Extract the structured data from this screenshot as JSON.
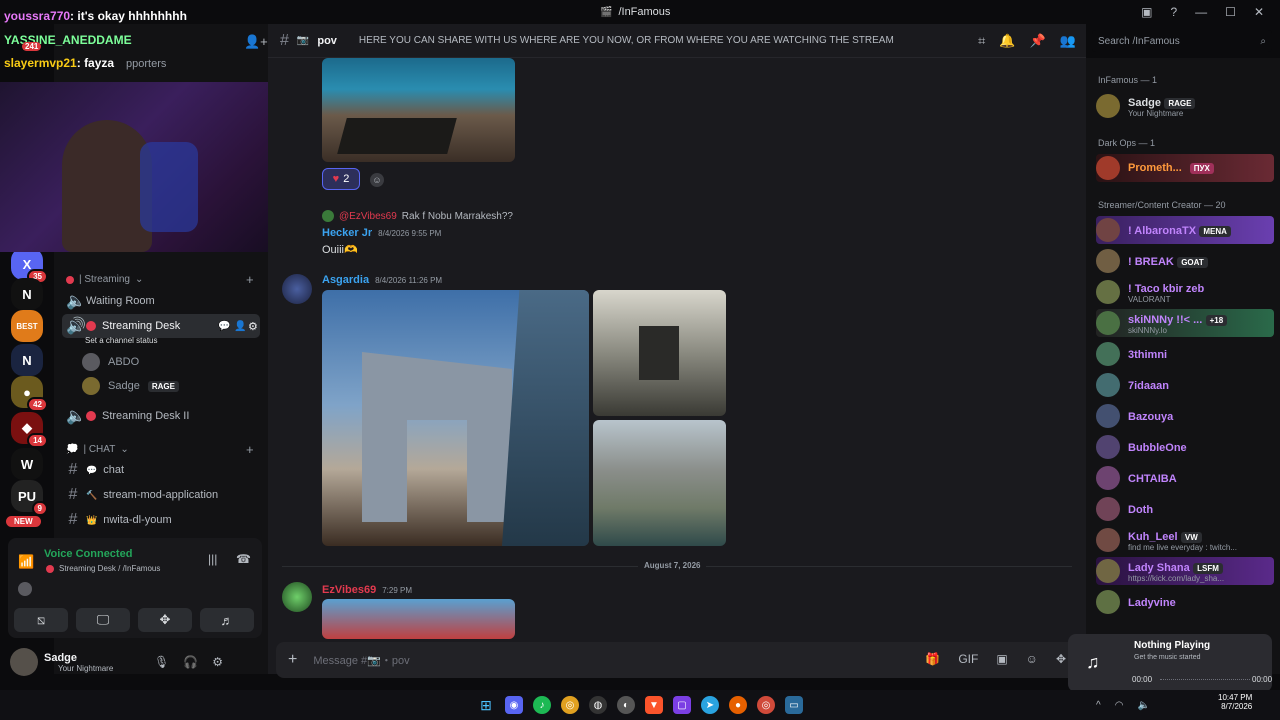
{
  "window": {
    "title": "/InFamous"
  },
  "stream_overlay": {
    "chat": [
      {
        "user": "youssra770",
        "text": ": it's okay hhhhhhhh"
      },
      {
        "user": "YASSINE_ANEDDAME",
        "text": ""
      },
      {
        "user": "slayermvp21",
        "text": ": fayza"
      }
    ],
    "badge_241": "241",
    "supporters_fragment": "pporters"
  },
  "servers": [
    {
      "name": "server-x",
      "glyph": "X",
      "badge": "35",
      "color": "#5865f2"
    },
    {
      "name": "server-n",
      "glyph": "N",
      "badge": "",
      "color": "#111"
    },
    {
      "name": "server-best",
      "glyph": "BEST",
      "badge": "",
      "color": "#e07b1a"
    },
    {
      "name": "server-nexora",
      "glyph": "N",
      "badge": "",
      "color": "#1a2440"
    },
    {
      "name": "server-gold",
      "glyph": "●",
      "badge": "42",
      "color": "#6b5a1e"
    },
    {
      "name": "server-red",
      "glyph": "◆",
      "badge": "14",
      "color": "#7a1010"
    },
    {
      "name": "server-w",
      "glyph": "W",
      "badge": "",
      "color": "#111"
    },
    {
      "name": "server-pu",
      "glyph": "PU",
      "badge": "9",
      "color": "#222"
    }
  ],
  "new_label": "NEW",
  "channels": {
    "category_streaming": "| Streaming",
    "waiting_room": "Waiting Room",
    "streaming_desk": "Streaming Desk",
    "set_status": "Set a channel status",
    "voice_users": [
      {
        "name": "ABDO",
        "tag": ""
      },
      {
        "name": "Sadge",
        "tag": "RAGE"
      }
    ],
    "streaming_desk_2": "Streaming Desk II",
    "category_chat": "| CHAT",
    "text_channels": [
      {
        "name": "chat",
        "emoji": "💬"
      },
      {
        "name": "stream-mod-application",
        "emoji": "🔨"
      },
      {
        "name": "nwita-dl-youm",
        "emoji": "👑"
      }
    ]
  },
  "voice_panel": {
    "status": "Voice Connected",
    "location": "Streaming Desk / /InFamous"
  },
  "user_panel": {
    "name": "Sadge",
    "status": "Your Nightmare"
  },
  "channel_header": {
    "name": "pov",
    "topic": "HERE YOU CAN SHARE WITH US WHERE ARE YOU NOW, OR FROM WHERE YOU ARE WATCHING THE STREAM",
    "search_placeholder": "Search /InFamous"
  },
  "messages": {
    "reaction_count": "2",
    "reply_ref_user": "@EzVibes69",
    "reply_ref_text": "Rak f Nobu Marrakesh??",
    "hecker": {
      "name": "Hecker Jr",
      "time": "8/4/2026 9:55 PM",
      "text": "Ouiii🫶"
    },
    "asgardia": {
      "name": "Asgardia",
      "time": "8/4/2026 11:26 PM"
    },
    "date_divider": "August 7, 2026",
    "ezvibes": {
      "name": "EzVibes69",
      "time": "7:29 PM"
    },
    "input_placeholder": "Message #📷・pov"
  },
  "members": {
    "cat_infamous": "InFamous — 1",
    "cat_darkops": "Dark Ops — 1",
    "cat_streamer": "Streamer/Content Creator — 20",
    "list_top": [
      {
        "name": "Sadge",
        "sub": "Your Nightmare",
        "tag": "RAGE",
        "color": "#dbdee1"
      },
      {
        "name": "Prometh...",
        "sub": "",
        "tag": "ПУХ",
        "color": "#ff9a3c"
      }
    ],
    "list": [
      {
        "name": "! AlbaronaTX",
        "sub": "",
        "tag": "MENA",
        "color": "#c084fc"
      },
      {
        "name": "! BREAK",
        "sub": "",
        "tag": "GOAT",
        "color": "#c084fc"
      },
      {
        "name": "! Taco kbir zeb",
        "sub": "VALORANT",
        "tag": "",
        "color": "#c084fc"
      },
      {
        "name": "skiNNNy !!< ...",
        "sub": "skiNNNy.lo",
        "tag": "+18",
        "color": "#c084fc"
      },
      {
        "name": "3thimni",
        "sub": "",
        "tag": "",
        "color": "#c084fc"
      },
      {
        "name": "7idaaan",
        "sub": "",
        "tag": "",
        "color": "#c084fc"
      },
      {
        "name": "Bazouya",
        "sub": "",
        "tag": "",
        "color": "#c084fc"
      },
      {
        "name": "BubbleOne",
        "sub": "",
        "tag": "",
        "color": "#c084fc"
      },
      {
        "name": "CHTAIBA",
        "sub": "",
        "tag": "",
        "color": "#c084fc"
      },
      {
        "name": "Doth",
        "sub": "",
        "tag": "",
        "color": "#c084fc"
      },
      {
        "name": "Kuh_Leel",
        "sub": "find me live everyday : twitch...",
        "tag": "VW",
        "color": "#c084fc"
      },
      {
        "name": "Lady Shana",
        "sub": "https://kick.com/lady_sha...",
        "tag": "LSFM",
        "color": "#c084fc"
      },
      {
        "name": "Ladyvine",
        "sub": "",
        "tag": "",
        "color": "#c084fc"
      }
    ]
  },
  "player": {
    "title": "Nothing Playing",
    "subtitle": "Get the music started",
    "start": "00:00",
    "end": "00:00"
  },
  "clock": {
    "time": "10:47 PM",
    "date": "8/7/2026"
  }
}
